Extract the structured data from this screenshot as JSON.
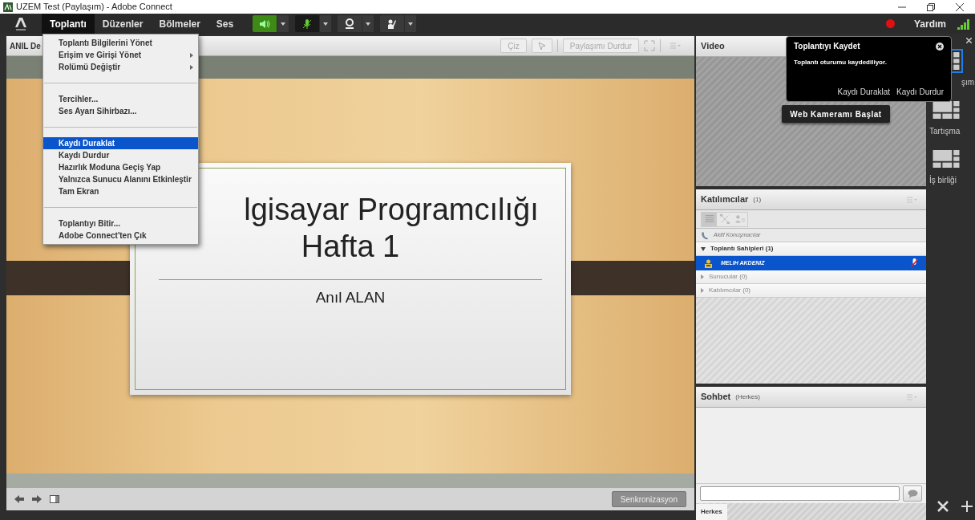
{
  "window": {
    "title": "UZEM Test (Paylaşım) - Adobe Connect"
  },
  "menubar": {
    "items": [
      {
        "label": "Toplantı",
        "selected": true
      },
      {
        "label": "Düzenler",
        "selected": false
      },
      {
        "label": "Bölmeler",
        "selected": false
      },
      {
        "label": "Ses",
        "selected": false
      }
    ],
    "help": "Yardım"
  },
  "menu": [
    {
      "kind": "item",
      "label": "Toplantı Bilgilerini Yönet",
      "submenu": false,
      "selected": false
    },
    {
      "kind": "item",
      "label": "Erişim ve Girişi Yönet",
      "submenu": true,
      "selected": false
    },
    {
      "kind": "item",
      "label": "Rolümü Değiştir",
      "submenu": true,
      "selected": false
    },
    {
      "kind": "separator"
    },
    {
      "kind": "item",
      "label": "Tercihler...",
      "submenu": false,
      "selected": false
    },
    {
      "kind": "item",
      "label": "Ses Ayarı Sihirbazı...",
      "submenu": false,
      "selected": false
    },
    {
      "kind": "separator"
    },
    {
      "kind": "item",
      "label": "Kaydı Duraklat",
      "submenu": false,
      "selected": true
    },
    {
      "kind": "item",
      "label": "Kaydı Durdur",
      "submenu": false,
      "selected": false
    },
    {
      "kind": "item",
      "label": "Hazırlık Moduna Geçiş Yap",
      "submenu": false,
      "selected": false
    },
    {
      "kind": "item",
      "label": "Yalnızca Sunucu Alanını Etkinleştir",
      "submenu": false,
      "selected": false
    },
    {
      "kind": "item",
      "label": "Tam Ekran",
      "submenu": false,
      "selected": false
    },
    {
      "kind": "separator"
    },
    {
      "kind": "item",
      "label": "Toplantıyı Bitir...",
      "submenu": false,
      "selected": false
    },
    {
      "kind": "item",
      "label": "Adobe Connect'ten Çık",
      "submenu": false,
      "selected": false
    }
  ],
  "share_pod": {
    "title": "ANIL De",
    "buttons": {
      "draw": "Çiz",
      "stop": "Paylaşımı Durdur"
    },
    "sync": "Senkronizasyon"
  },
  "slide": {
    "title": "lgisayar Programcılığı",
    "subtitle": "Hafta 1",
    "author": "Anıl ALAN"
  },
  "video_pod": {
    "title": "Video",
    "start_button": "Web Kameramı Başlat"
  },
  "record_popup": {
    "title": "Toplantıyı Kaydet",
    "message": "Toplantı oturumu kaydediliyor.",
    "actions": [
      "Kaydı Duraklat",
      "Kaydı Durdur"
    ]
  },
  "attendees_pod": {
    "title": "Katılımcılar",
    "count": "(1)",
    "active_speakers": "Aktif Konuşmacılar",
    "groups": [
      {
        "label": "Toplantı Sahipleri (1)",
        "expanded": true,
        "members": [
          {
            "name": "MELIH AKDENIZ",
            "selected": true
          }
        ]
      },
      {
        "label": "Sunucular (0)",
        "expanded": false
      },
      {
        "label": "Katılımcılar (0)",
        "expanded": false
      }
    ]
  },
  "chat_pod": {
    "title": "Sohbet",
    "scope": "(Herkes)",
    "tabs": [
      {
        "label": "Herkes",
        "selected": true
      }
    ]
  },
  "layouts": [
    {
      "label": "şım",
      "selected": true
    },
    {
      "label": "Tartışma",
      "selected": false
    },
    {
      "label": "İş birliği",
      "selected": false
    }
  ]
}
